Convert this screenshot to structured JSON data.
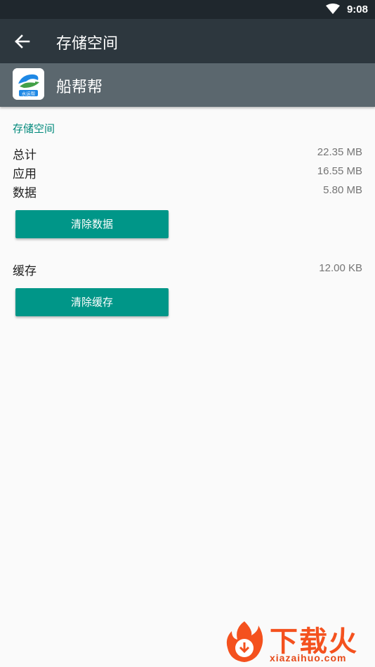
{
  "status_bar": {
    "time": "9:08",
    "wifi_icon": "wifi-icon"
  },
  "toolbar": {
    "title": "存储空间",
    "back_icon": "arrow-back-icon"
  },
  "app": {
    "name": "船帮帮",
    "icon_caption": "水运帮"
  },
  "storage": {
    "section_title": "存储空间",
    "total_label": "总计",
    "total_value": "22.35 MB",
    "apps_label": "应用",
    "apps_value": "16.55 MB",
    "data_label": "数据",
    "data_value": "5.80 MB",
    "clear_data_label": "清除数据",
    "cache_label": "缓存",
    "cache_value": "12.00 KB",
    "clear_cache_label": "清除缓存"
  },
  "watermark": {
    "text": "下载火",
    "url": "xiazaihuo.com"
  },
  "colors": {
    "accent": "#009688",
    "toolbar": "#2d373e",
    "header": "#5b676e",
    "status_bar": "#1f272d"
  }
}
